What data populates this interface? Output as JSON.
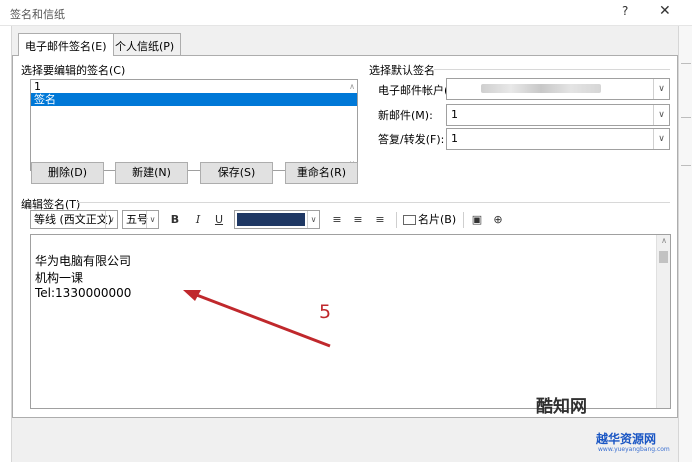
{
  "window": {
    "title": "签名和信纸",
    "help": "?",
    "close": "✕"
  },
  "tabs": [
    {
      "label": "电子邮件签名(E)"
    },
    {
      "label": "个人信纸(P)"
    }
  ],
  "select_signature": {
    "label": "选择要编辑的签名(C)",
    "items": [
      "1",
      "签名"
    ],
    "selected_index": 1
  },
  "buttons": {
    "delete": "删除(D)",
    "new": "新建(N)",
    "save": "保存(S)",
    "rename": "重命名(R)"
  },
  "default_signature": {
    "label": "选择默认签名",
    "account_label": "电子邮件帐户(A):",
    "new_message_label": "新邮件(M):",
    "new_message_value": "1",
    "reply_label": "答复/转发(F):",
    "reply_value": "1"
  },
  "edit": {
    "label": "编辑签名(T)",
    "font": "等线 (西文正文)",
    "size": "五号",
    "bold": "B",
    "italic": "I",
    "underline": "U",
    "font_color": "#1f3864",
    "business_card": "名片(B)",
    "lines": [
      "华为电脑有限公司",
      "机构一课",
      "Tel:1330000000"
    ]
  },
  "annotation": {
    "number": "5",
    "color": "#c0282c"
  },
  "watermark": {
    "brand1": "酷知网",
    "brand2": "越华资源网",
    "url": "www.yueyangbang.com"
  }
}
